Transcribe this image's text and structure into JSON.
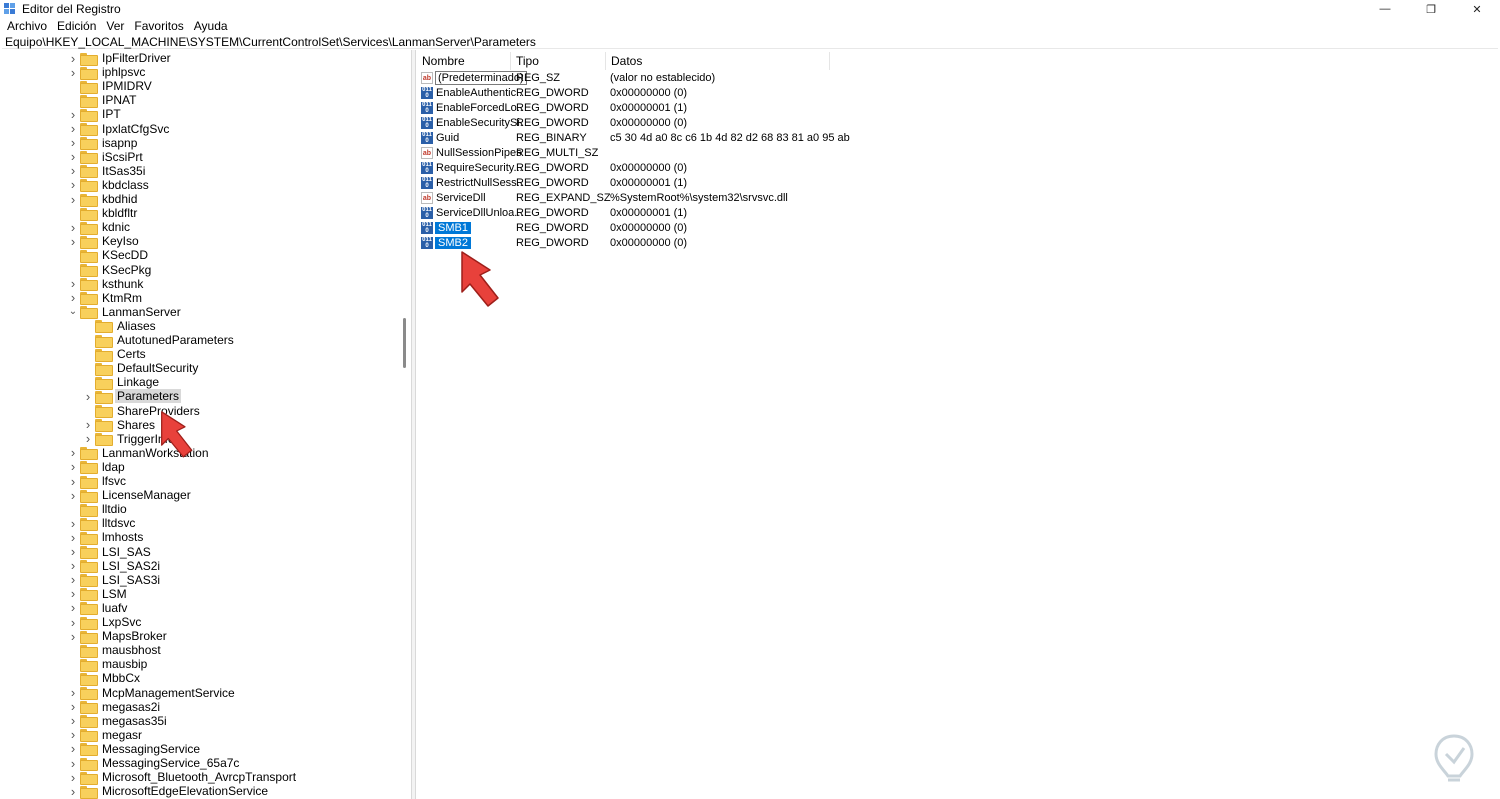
{
  "window": {
    "title": "Editor del Registro",
    "minimize_glyph": "—",
    "restore_glyph": "❐",
    "close_glyph": "✕"
  },
  "menu": [
    "Archivo",
    "Edición",
    "Ver",
    "Favoritos",
    "Ayuda"
  ],
  "address": "Equipo\\HKEY_LOCAL_MACHINE\\SYSTEM\\CurrentControlSet\\Services\\LanmanServer\\Parameters",
  "tree": [
    {
      "label": "IpFilterDriver",
      "depth": 0,
      "chevron": "right"
    },
    {
      "label": "iphlpsvc",
      "depth": 0,
      "chevron": "right"
    },
    {
      "label": "IPMIDRV",
      "depth": 0,
      "chevron": "none"
    },
    {
      "label": "IPNAT",
      "depth": 0,
      "chevron": "none"
    },
    {
      "label": "IPT",
      "depth": 0,
      "chevron": "right"
    },
    {
      "label": "IpxlatCfgSvc",
      "depth": 0,
      "chevron": "right"
    },
    {
      "label": "isapnp",
      "depth": 0,
      "chevron": "right"
    },
    {
      "label": "iScsiPrt",
      "depth": 0,
      "chevron": "right"
    },
    {
      "label": "ItSas35i",
      "depth": 0,
      "chevron": "right"
    },
    {
      "label": "kbdclass",
      "depth": 0,
      "chevron": "right"
    },
    {
      "label": "kbdhid",
      "depth": 0,
      "chevron": "right"
    },
    {
      "label": "kbldfltr",
      "depth": 0,
      "chevron": "none"
    },
    {
      "label": "kdnic",
      "depth": 0,
      "chevron": "right"
    },
    {
      "label": "KeyIso",
      "depth": 0,
      "chevron": "right"
    },
    {
      "label": "KSecDD",
      "depth": 0,
      "chevron": "none"
    },
    {
      "label": "KSecPkg",
      "depth": 0,
      "chevron": "none"
    },
    {
      "label": "ksthunk",
      "depth": 0,
      "chevron": "right"
    },
    {
      "label": "KtmRm",
      "depth": 0,
      "chevron": "right"
    },
    {
      "label": "LanmanServer",
      "depth": 0,
      "chevron": "down"
    },
    {
      "label": "Aliases",
      "depth": 1,
      "chevron": "none"
    },
    {
      "label": "AutotunedParameters",
      "depth": 1,
      "chevron": "none"
    },
    {
      "label": "Certs",
      "depth": 1,
      "chevron": "none"
    },
    {
      "label": "DefaultSecurity",
      "depth": 1,
      "chevron": "none"
    },
    {
      "label": "Linkage",
      "depth": 1,
      "chevron": "none"
    },
    {
      "label": "Parameters",
      "depth": 1,
      "chevron": "right",
      "selected": true
    },
    {
      "label": "ShareProviders",
      "depth": 1,
      "chevron": "none"
    },
    {
      "label": "Shares",
      "depth": 1,
      "chevron": "right"
    },
    {
      "label": "TriggerInfo",
      "depth": 1,
      "chevron": "right"
    },
    {
      "label": "LanmanWorkstation",
      "depth": 0,
      "chevron": "right"
    },
    {
      "label": "ldap",
      "depth": 0,
      "chevron": "right"
    },
    {
      "label": "lfsvc",
      "depth": 0,
      "chevron": "right"
    },
    {
      "label": "LicenseManager",
      "depth": 0,
      "chevron": "right"
    },
    {
      "label": "lltdio",
      "depth": 0,
      "chevron": "none"
    },
    {
      "label": "lltdsvc",
      "depth": 0,
      "chevron": "right"
    },
    {
      "label": "lmhosts",
      "depth": 0,
      "chevron": "right"
    },
    {
      "label": "LSI_SAS",
      "depth": 0,
      "chevron": "right"
    },
    {
      "label": "LSI_SAS2i",
      "depth": 0,
      "chevron": "right"
    },
    {
      "label": "LSI_SAS3i",
      "depth": 0,
      "chevron": "right"
    },
    {
      "label": "LSM",
      "depth": 0,
      "chevron": "right"
    },
    {
      "label": "luafv",
      "depth": 0,
      "chevron": "right"
    },
    {
      "label": "LxpSvc",
      "depth": 0,
      "chevron": "right"
    },
    {
      "label": "MapsBroker",
      "depth": 0,
      "chevron": "right"
    },
    {
      "label": "mausbhost",
      "depth": 0,
      "chevron": "none"
    },
    {
      "label": "mausbip",
      "depth": 0,
      "chevron": "none"
    },
    {
      "label": "MbbCx",
      "depth": 0,
      "chevron": "none"
    },
    {
      "label": "McpManagementService",
      "depth": 0,
      "chevron": "right"
    },
    {
      "label": "megasas2i",
      "depth": 0,
      "chevron": "right"
    },
    {
      "label": "megasas35i",
      "depth": 0,
      "chevron": "right"
    },
    {
      "label": "megasr",
      "depth": 0,
      "chevron": "right"
    },
    {
      "label": "MessagingService",
      "depth": 0,
      "chevron": "right"
    },
    {
      "label": "MessagingService_65a7c",
      "depth": 0,
      "chevron": "right"
    },
    {
      "label": "Microsoft_Bluetooth_AvrcpTransport",
      "depth": 0,
      "chevron": "right"
    },
    {
      "label": "MicrosoftEdgeElevationService",
      "depth": 0,
      "chevron": "right"
    }
  ],
  "columns": {
    "name": "Nombre",
    "type": "Tipo",
    "data": "Datos"
  },
  "values": [
    {
      "icon": "ab",
      "name": "(Predeterminado)",
      "type": "REG_SZ",
      "data": "(valor no establecido)",
      "state": "editing"
    },
    {
      "icon": "bin",
      "name": "EnableAuthentic...",
      "type": "REG_DWORD",
      "data": "0x00000000 (0)"
    },
    {
      "icon": "bin",
      "name": "EnableForcedLo...",
      "type": "REG_DWORD",
      "data": "0x00000001 (1)"
    },
    {
      "icon": "bin",
      "name": "EnableSecuritySi...",
      "type": "REG_DWORD",
      "data": "0x00000000 (0)"
    },
    {
      "icon": "bin",
      "name": "Guid",
      "type": "REG_BINARY",
      "data": "c5 30 4d a0 8c c6 1b 4d 82 d2 68 83 81 a0 95 ab"
    },
    {
      "icon": "ab",
      "name": "NullSessionPipes",
      "type": "REG_MULTI_SZ",
      "data": ""
    },
    {
      "icon": "bin",
      "name": "RequireSecurity...",
      "type": "REG_DWORD",
      "data": "0x00000000 (0)"
    },
    {
      "icon": "bin",
      "name": "RestrictNullSess...",
      "type": "REG_DWORD",
      "data": "0x00000001 (1)"
    },
    {
      "icon": "ab",
      "name": "ServiceDll",
      "type": "REG_EXPAND_SZ",
      "data": "%SystemRoot%\\system32\\srvsvc.dll"
    },
    {
      "icon": "bin",
      "name": "ServiceDllUnloa...",
      "type": "REG_DWORD",
      "data": "0x00000001 (1)"
    },
    {
      "icon": "bin",
      "name": "SMB1",
      "type": "REG_DWORD",
      "data": "0x00000000 (0)",
      "state": "selected"
    },
    {
      "icon": "bin",
      "name": "SMB2",
      "type": "REG_DWORD",
      "data": "0x00000000 (0)",
      "state": "selected"
    }
  ],
  "icon_glyphs": {
    "ab": "ab",
    "bin": "0110"
  },
  "colors": {
    "selection": "#0078d7",
    "folder": "#f8d05c",
    "arrow": "#e8413b",
    "tree_selected": "#d9d9d9"
  }
}
